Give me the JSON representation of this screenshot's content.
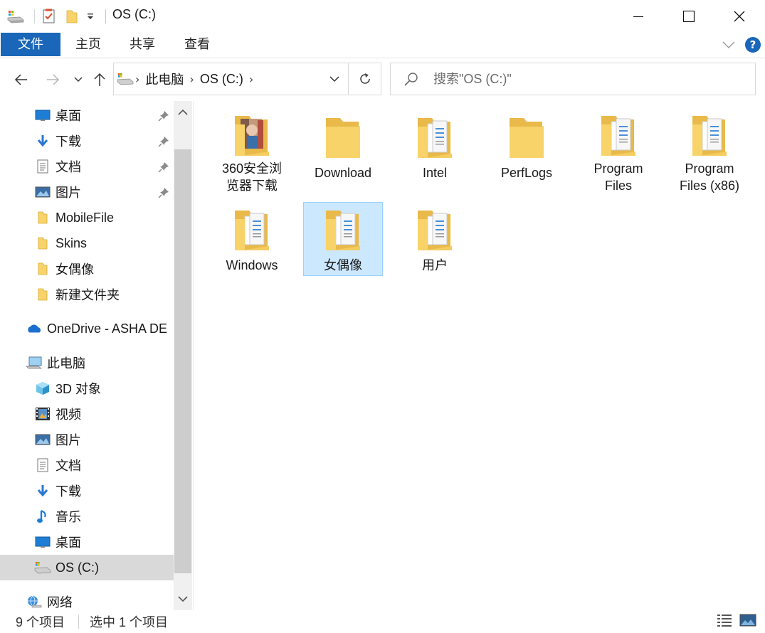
{
  "window": {
    "title": "OS (C:)",
    "minimize_glyph": "—",
    "maximize_glyph": "☐",
    "close_glyph": "✕"
  },
  "ribbon": {
    "tabs": [
      "文件",
      "主页",
      "共享",
      "查看"
    ],
    "help_glyph": "?",
    "accent_color": "#1a66b8"
  },
  "address": {
    "crumbs": [
      "此电脑",
      "OS (C:)"
    ],
    "search_placeholder": "搜索\"OS (C:)\""
  },
  "nav": {
    "quick_access": [
      {
        "label": "桌面",
        "icon": "desktop-icon",
        "pinned": true
      },
      {
        "label": "下载",
        "icon": "download-icon",
        "pinned": true
      },
      {
        "label": "文档",
        "icon": "documents-icon",
        "pinned": true
      },
      {
        "label": "图片",
        "icon": "pictures-icon",
        "pinned": true
      },
      {
        "label": "MobileFile",
        "icon": "folder-icon",
        "pinned": false
      },
      {
        "label": "Skins",
        "icon": "folder-icon",
        "pinned": false
      },
      {
        "label": "女偶像",
        "icon": "folder-icon",
        "pinned": false
      },
      {
        "label": "新建文件夹",
        "icon": "folder-icon",
        "pinned": false
      }
    ],
    "onedrive": "OneDrive - ASHA DE",
    "this_pc": "此电脑",
    "pc_items": [
      {
        "label": "3D 对象",
        "icon": "3d-objects-icon"
      },
      {
        "label": "视频",
        "icon": "videos-icon"
      },
      {
        "label": "图片",
        "icon": "pictures-icon"
      },
      {
        "label": "文档",
        "icon": "documents-icon"
      },
      {
        "label": "下载",
        "icon": "download-icon"
      },
      {
        "label": "音乐",
        "icon": "music-icon"
      },
      {
        "label": "桌面",
        "icon": "desktop-icon"
      },
      {
        "label": "OS (C:)",
        "icon": "drive-icon"
      }
    ],
    "network": "网络"
  },
  "content": {
    "items": [
      {
        "line1": "360安全浏",
        "line2": "览器下载",
        "icon": "folder-photo-icon"
      },
      {
        "line1": "Download",
        "line2": "",
        "icon": "folder-icon"
      },
      {
        "line1": "Intel",
        "line2": "",
        "icon": "folder-docs-icon"
      },
      {
        "line1": "PerfLogs",
        "line2": "",
        "icon": "folder-icon"
      },
      {
        "line1": "Program",
        "line2": "Files",
        "icon": "folder-docs-icon"
      },
      {
        "line1": "Program",
        "line2": "Files (x86)",
        "icon": "folder-docs-icon"
      },
      {
        "line1": "Windows",
        "line2": "",
        "icon": "folder-docs-icon"
      },
      {
        "line1": "女偶像",
        "line2": "",
        "icon": "folder-docs-icon",
        "selected": true
      },
      {
        "line1": "用户",
        "line2": "",
        "icon": "folder-docs-icon"
      }
    ]
  },
  "status": {
    "item_count": "9 个项目",
    "selected_count": "选中 1 个项目"
  },
  "colors": {
    "selection_fill": "#cce8ff",
    "selection_border": "#99d1ff",
    "folder_yellow": "#f8d36a"
  }
}
